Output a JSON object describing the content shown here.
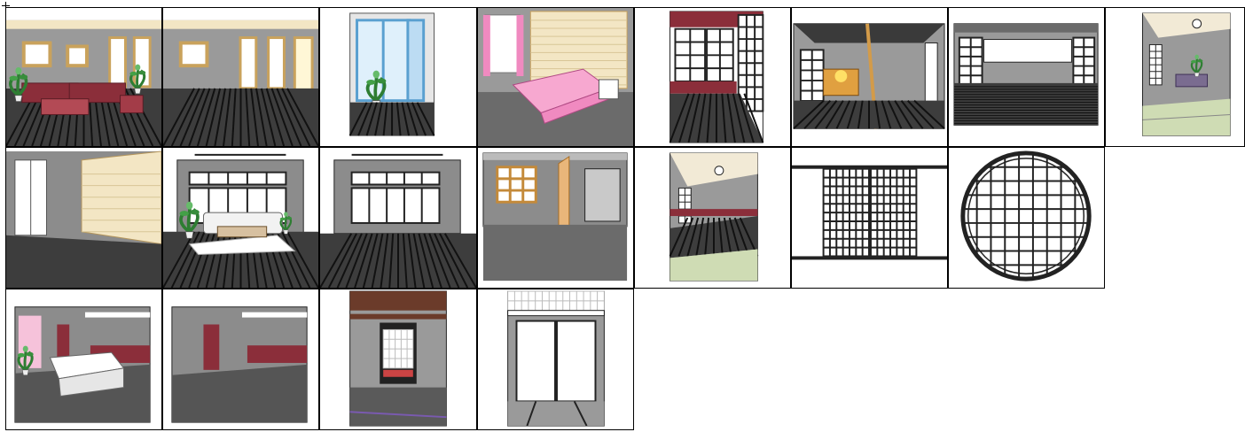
{
  "gallery": {
    "items": [
      {
        "name": "tile-western-living-room-furnished",
        "kind": "living"
      },
      {
        "name": "tile-western-living-room-empty",
        "kind": "living-empty"
      },
      {
        "name": "tile-window-with-plant",
        "kind": "window"
      },
      {
        "name": "tile-bedroom-pink-bed",
        "kind": "bedroom"
      },
      {
        "name": "tile-japanese-shoji-corridor",
        "kind": "shoji-corridor"
      },
      {
        "name": "tile-japanese-room-tokonoma",
        "kind": "tokonoma"
      },
      {
        "name": "tile-japanese-room-front-view",
        "kind": "jp-front"
      },
      {
        "name": "tile-japanese-tatami-room-with-table",
        "kind": "tatami-table"
      },
      {
        "name": "tile-room-with-wood-panel-wall",
        "kind": "panel-wall"
      },
      {
        "name": "tile-living-room-white-sofa",
        "kind": "white-sofa"
      },
      {
        "name": "tile-empty-room-window-wall",
        "kind": "window-wall"
      },
      {
        "name": "tile-room-with-open-door",
        "kind": "open-door"
      },
      {
        "name": "tile-japanese-tatami-room-empty",
        "kind": "tatami-empty"
      },
      {
        "name": "tile-shoji-sliding-doors",
        "kind": "shoji-doors"
      },
      {
        "name": "tile-round-lattice-window",
        "kind": "round-window"
      },
      {
        "name": "tile-modern-room-with-sofa",
        "kind": "modern-sofa"
      },
      {
        "name": "tile-modern-room-empty",
        "kind": "modern-empty"
      },
      {
        "name": "tile-japanese-interior-alcove",
        "kind": "jp-alcove"
      },
      {
        "name": "tile-japanese-room-lattice-transom",
        "kind": "jp-transom"
      }
    ]
  },
  "colors": {
    "floor_dark": "#3d3d3d",
    "wall_gray": "#8c8c8c",
    "wood_red": "#8b2e3a",
    "cream": "#f3e6c4",
    "tatami": "#cfdcb4",
    "pink": "#f08ac0"
  }
}
